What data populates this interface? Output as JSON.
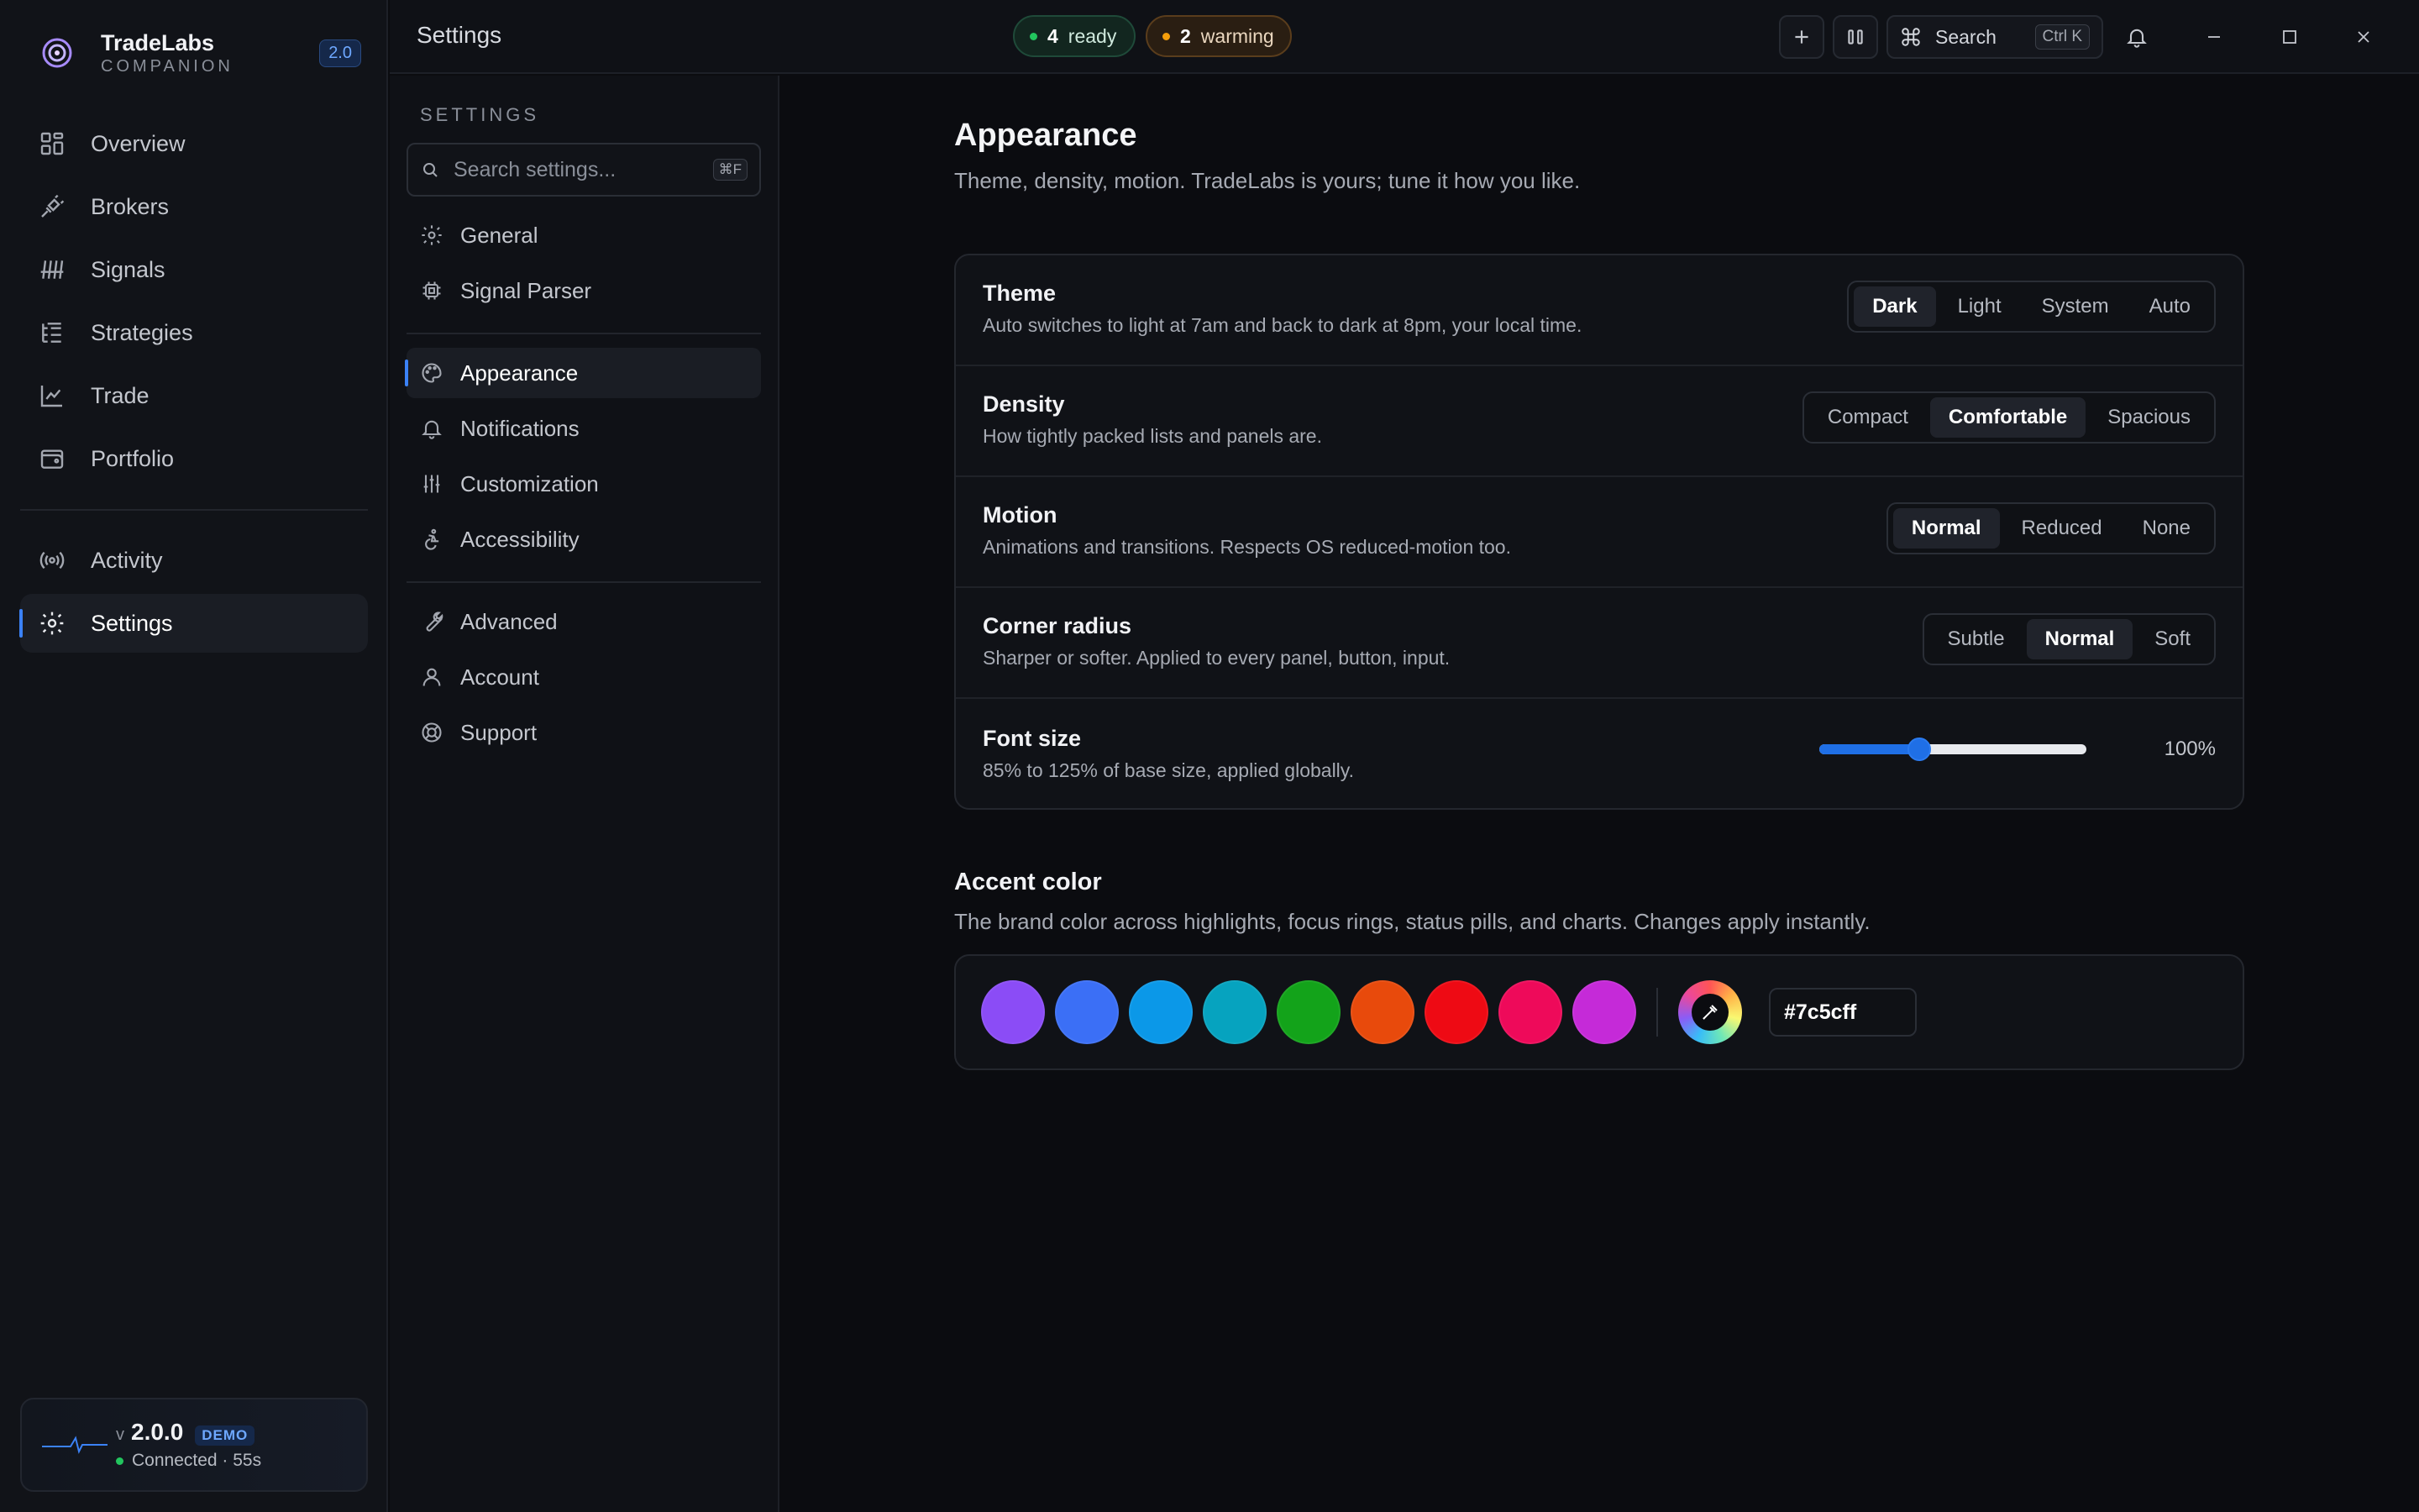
{
  "brand": {
    "name": "TradeLabs",
    "subtitle": "COMPANION",
    "version": "2.0"
  },
  "sidebar": {
    "items": [
      {
        "label": "Overview",
        "icon": "grid-icon"
      },
      {
        "label": "Brokers",
        "icon": "plug-icon"
      },
      {
        "label": "Signals",
        "icon": "signal-icon"
      },
      {
        "label": "Strategies",
        "icon": "list-tree-icon"
      },
      {
        "label": "Trade",
        "icon": "chart-line-icon"
      },
      {
        "label": "Portfolio",
        "icon": "wallet-icon"
      }
    ],
    "secondary": [
      {
        "label": "Activity",
        "icon": "broadcast-icon"
      },
      {
        "label": "Settings",
        "icon": "gear-icon",
        "active": true
      }
    ],
    "status": {
      "v": "v",
      "version": "2.0.0",
      "badge": "DEMO",
      "connection": "Connected · 55s",
      "connection_color": "#22c55e"
    }
  },
  "topbar": {
    "title": "Settings",
    "ready": {
      "count": "4",
      "label": "ready",
      "color": "#22c55e"
    },
    "warming": {
      "count": "2",
      "label": "warming",
      "color": "#f59e0b"
    },
    "search_label": "Search",
    "search_shortcut": "Ctrl K"
  },
  "settings_nav": {
    "heading": "SETTINGS",
    "search_placeholder": "Search settings...",
    "search_shortcut": "⌘F",
    "group1": [
      {
        "label": "General",
        "icon": "gear-icon"
      },
      {
        "label": "Signal Parser",
        "icon": "chip-icon"
      }
    ],
    "group2": [
      {
        "label": "Appearance",
        "icon": "palette-icon",
        "active": true
      },
      {
        "label": "Notifications",
        "icon": "bell-icon"
      },
      {
        "label": "Customization",
        "icon": "sliders-icon"
      },
      {
        "label": "Accessibility",
        "icon": "accessibility-icon"
      }
    ],
    "group3": [
      {
        "label": "Advanced",
        "icon": "wrench-icon"
      },
      {
        "label": "Account",
        "icon": "user-icon"
      },
      {
        "label": "Support",
        "icon": "lifebuoy-icon"
      }
    ]
  },
  "appearance": {
    "title": "Appearance",
    "subtitle": "Theme, density, motion. TradeLabs is yours; tune it how you like.",
    "theme": {
      "title": "Theme",
      "desc": "Auto switches to light at 7am and back to dark at 8pm, your local time.",
      "options": [
        "Dark",
        "Light",
        "System",
        "Auto"
      ],
      "selected": "Dark"
    },
    "density": {
      "title": "Density",
      "desc": "How tightly packed lists and panels are.",
      "options": [
        "Compact",
        "Comfortable",
        "Spacious"
      ],
      "selected": "Comfortable"
    },
    "motion": {
      "title": "Motion",
      "desc": "Animations and transitions. Respects OS reduced-motion too.",
      "options": [
        "Normal",
        "Reduced",
        "None"
      ],
      "selected": "Normal"
    },
    "radius": {
      "title": "Corner radius",
      "desc": "Sharper or softer. Applied to every panel, button, input.",
      "options": [
        "Subtle",
        "Normal",
        "Soft"
      ],
      "selected": "Normal"
    },
    "font_size": {
      "title": "Font size",
      "desc": "85% to 125% of base size, applied globally.",
      "value": 100,
      "min": 85,
      "max": 125,
      "value_label": "100%"
    }
  },
  "accent": {
    "title": "Accent color",
    "subtitle": "The brand color across highlights, focus rings, status pills, and charts. Changes apply instantly.",
    "swatches": [
      "#8b4cf6",
      "#3b6ff6",
      "#0b98e8",
      "#06a3bf",
      "#13a31a",
      "#e84a0c",
      "#ee0a14",
      "#ee0a5a",
      "#c52ad8"
    ],
    "picker_icon": "eyedropper-icon",
    "hex_value": "#7c5cff"
  }
}
